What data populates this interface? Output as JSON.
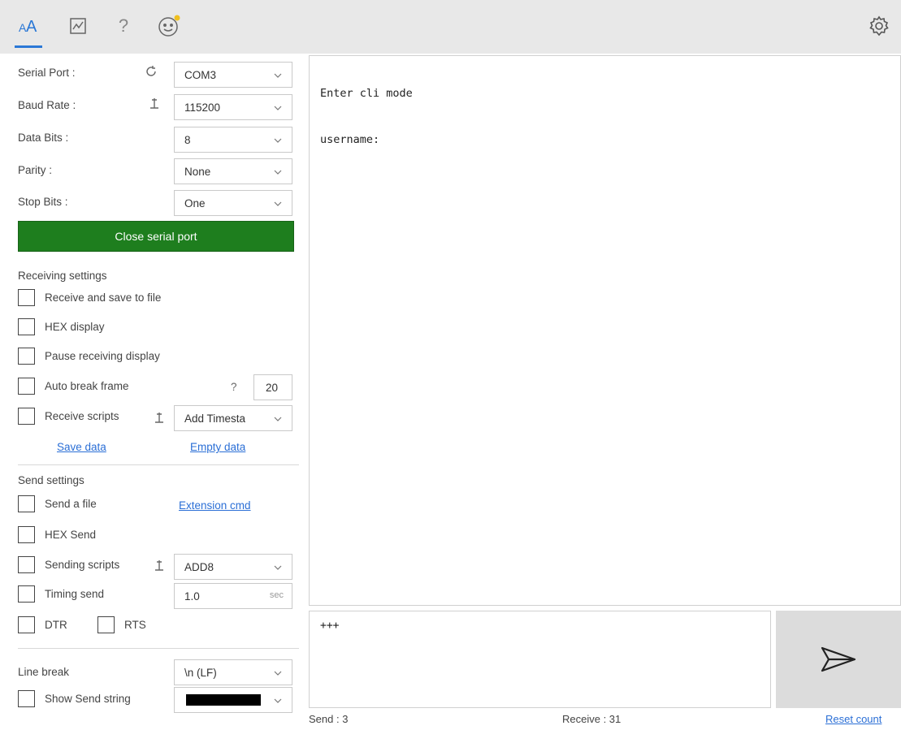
{
  "toolbar": {
    "icons": [
      "font-size-icon",
      "chart-icon",
      "help-icon",
      "smiley-icon",
      "settings-icon"
    ],
    "help_glyph": "?"
  },
  "serial": {
    "port_label": "Serial Port :",
    "port_value": "COM3",
    "baud_label": "Baud Rate :",
    "baud_value": "115200",
    "databits_label": "Data Bits :",
    "databits_value": "8",
    "parity_label": "Parity :",
    "parity_value": "None",
    "stopbits_label": "Stop Bits :",
    "stopbits_value": "One",
    "close_button": "Close serial port"
  },
  "receiving": {
    "title": "Receiving settings",
    "save_to_file": "Receive and save to file",
    "hex_display": "HEX display",
    "pause_display": "Pause receiving display",
    "auto_break": "Auto break frame",
    "auto_break_help": "?",
    "auto_break_value": "20",
    "receive_scripts": "Receive scripts",
    "receive_scripts_value": "Add Timesta",
    "save_data": "Save data",
    "empty_data": "Empty data"
  },
  "sending": {
    "title": "Send settings",
    "send_file": "Send a file",
    "extension_cmd": "Extension cmd",
    "hex_send": "HEX Send",
    "sending_scripts": "Sending scripts",
    "sending_scripts_value": "ADD8",
    "timing_send": "Timing send",
    "timing_value": "1.0",
    "timing_unit": "sec",
    "dtr": "DTR",
    "rts": "RTS"
  },
  "line": {
    "line_break_label": "Line break",
    "line_break_value": "\\n (LF)",
    "show_send_string": "Show Send string",
    "color_value": "#000000"
  },
  "terminal": {
    "lines": [
      "Enter cli mode",
      "",
      "",
      "username:"
    ]
  },
  "send_input": {
    "value": "+++"
  },
  "status": {
    "send": "Send : 3",
    "receive": "Receive : 31",
    "reset": "Reset count"
  },
  "colors": {
    "accent": "#2b78d6",
    "button_green": "#1e7e1e",
    "toolbar_bg": "#e8e8e8",
    "send_button_bg": "#dcdcdc"
  }
}
